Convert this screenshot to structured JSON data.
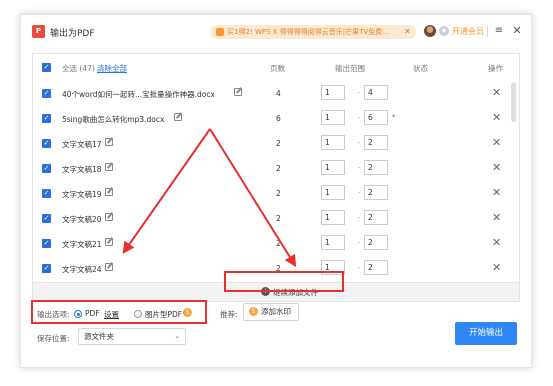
{
  "app": {
    "title": "输出为PDF",
    "logo": "P"
  },
  "promo": {
    "text": "买1得2! WPS X 得得得得阅得云音乐|芒果TV免费..."
  },
  "account": {
    "vip_label": "开通会员"
  },
  "header": {
    "all_label": "全选 (47)",
    "clear_label": "清除全部",
    "col_pages": "页数",
    "col_range": "输出范围",
    "col_status": "状态",
    "col_action": "操作"
  },
  "rows": [
    {
      "name": "40个word如何一起转...宝批量操作神器.docx",
      "pages": "4",
      "from": "1",
      "to": "4"
    },
    {
      "name": "5sing歌曲怎么转化mp3.docx",
      "pages": "6",
      "from": "1",
      "to": "6"
    },
    {
      "name": "文字文稿17",
      "pages": "2",
      "from": "1",
      "to": "2"
    },
    {
      "name": "文字文稿18",
      "pages": "2",
      "from": "1",
      "to": "2"
    },
    {
      "name": "文字文稿19",
      "pages": "2",
      "from": "1",
      "to": "2"
    },
    {
      "name": "文字文稿20",
      "pages": "2",
      "from": "1",
      "to": "2"
    },
    {
      "name": "文字文稿21",
      "pages": "2",
      "from": "1",
      "to": "2"
    },
    {
      "name": "文字文稿24",
      "pages": "2",
      "from": "1",
      "to": "2"
    }
  ],
  "add_files_label": "继续添加文件",
  "options": {
    "label": "输出选项:",
    "pdf": "PDF",
    "settings": "设置",
    "image_pdf": "图片型PDF"
  },
  "recommend": {
    "label": "推荐:",
    "watermark": "添加水印"
  },
  "save": {
    "label": "保存位置:",
    "value": "源文件夹"
  },
  "start_label": "开始输出"
}
